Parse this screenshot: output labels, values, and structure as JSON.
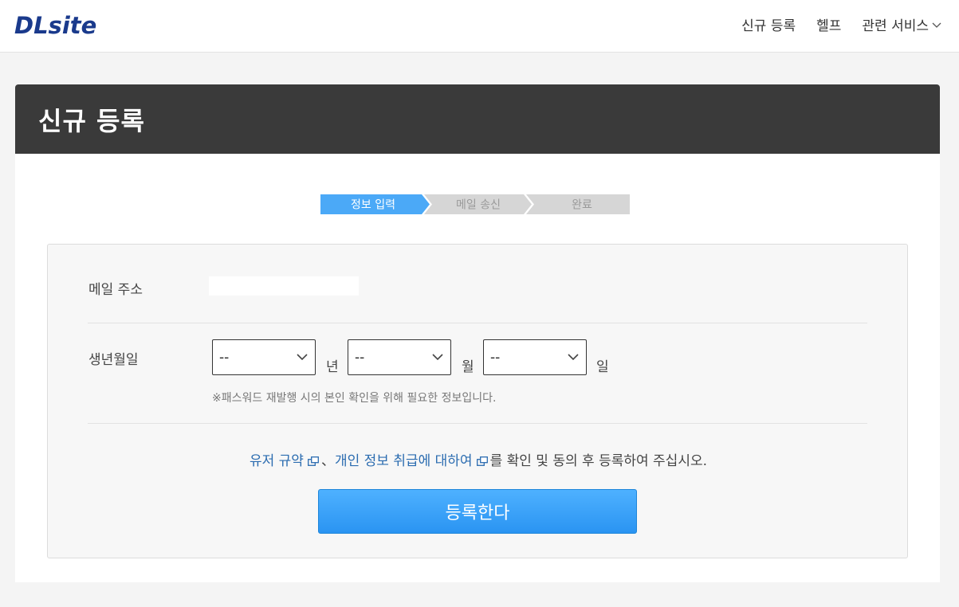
{
  "header": {
    "logo_text": "DLsite",
    "nav": [
      {
        "label": "신규 등록"
      },
      {
        "label": "헬프"
      },
      {
        "label": "관련 서비스"
      }
    ]
  },
  "page": {
    "title": "신규 등록"
  },
  "steps": [
    {
      "label": "정보 입력",
      "active": true
    },
    {
      "label": "메일 송신",
      "active": false
    },
    {
      "label": "완료",
      "active": false
    }
  ],
  "form": {
    "email_label": "메일 주소",
    "birthday_label": "생년월일",
    "year_value": "--",
    "month_value": "--",
    "day_value": "--",
    "year_unit": "년",
    "month_unit": "월",
    "day_unit": "일",
    "birthday_note": "※패스워드 재발행 시의 본인 확인을 위해 필요한 정보입니다."
  },
  "agreement": {
    "terms_link": "유저 규약",
    "separator": "、",
    "privacy_link": "개인 정보 취급에 대하여",
    "suffix": "를 확인 및 동의 후 등록하여 주십시오."
  },
  "submit_label": "등록한다",
  "colors": {
    "accent": "#2a94f2",
    "step_active": "#4ba9f7",
    "step_inactive": "#d6d6d6",
    "header_bar": "#3a3a3a",
    "logo": "#1a3a8c"
  }
}
